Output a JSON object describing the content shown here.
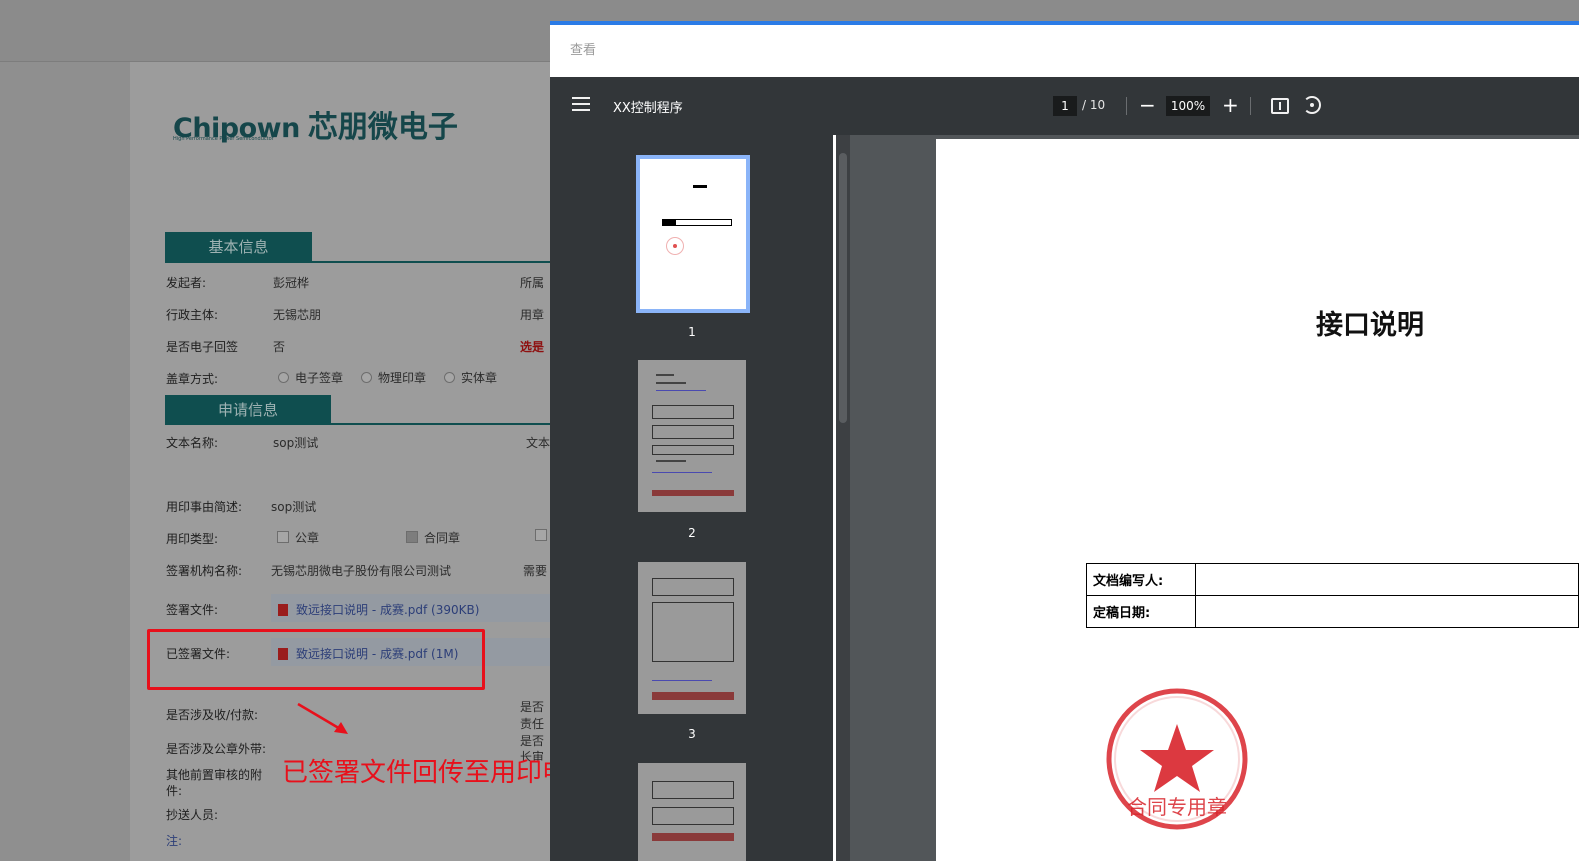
{
  "app": {
    "background_labels": []
  },
  "form": {
    "logo_en": "Chipown",
    "logo_cn": "芯朋微电子",
    "logo_sub": "High Performance Power Semiconductor",
    "section_basic": "基本信息",
    "section_apply": "申请信息",
    "initiator_label": "发起者:",
    "initiator_value": "彭冠桦",
    "initiator_right": "所属",
    "admin_label": "行政主体:",
    "admin_value": "无锡芯朋",
    "admin_right": "用章",
    "esign_label": "是否电子回签",
    "esign_value": "否",
    "esign_right": "选是",
    "seal_mode_label": "盖章方式:",
    "seal_modes": [
      "电子签章",
      "物理印章",
      "实体章"
    ],
    "doc_name_label": "文本名称:",
    "doc_name_value": "sop测试",
    "doc_name_right": "文本",
    "reason_label": "用印事由简述:",
    "reason_value": "sop测试",
    "seal_type_label": "用印类型:",
    "seal_types": [
      "公章",
      "合同章"
    ],
    "org_label": "签署机构名称:",
    "org_value": "无锡芯朋微电子股份有限公司测试",
    "org_right": "需要",
    "sign_file_label": "签署文件:",
    "sign_file_value": "致远接口说明 - 成赛.pdf (390KB)",
    "signed_file_label": "已签署文件:",
    "signed_file_value": "致远接口说明 - 成赛.pdf (1M)",
    "payment_label": "是否涉及收/付款:",
    "payment_right": "是否",
    "payment_right2": "责任",
    "external_label": "是否涉及公章外带:",
    "external_right": "是否",
    "external_right2": "长审",
    "other_label": "其他前置审核的附件:",
    "cc_label": "抄送人员:",
    "note_label": "注:"
  },
  "annotation": {
    "text": "已签署文件回传至用印申请单",
    "color": "#e8101b"
  },
  "viewer": {
    "dialog_title": "查看",
    "doc_title": "XX控制程序",
    "current_page": "1",
    "total_pages": "/ 10",
    "zoom": "100%",
    "zoom_out_icon": "minus-icon",
    "zoom_in_icon": "plus-icon",
    "fit_icon": "fit-page-icon",
    "rotate_icon": "rotate-icon",
    "thumbnails": [
      "1",
      "2",
      "3"
    ],
    "accent_color": "#2b7be6"
  },
  "document": {
    "heading": "接口说明",
    "table": [
      {
        "label": "文档编写人:",
        "value": ""
      },
      {
        "label": "定稿日期:",
        "value": ""
      }
    ],
    "stamp_text": "合同专用章",
    "stamp_color": "#d8242b"
  }
}
